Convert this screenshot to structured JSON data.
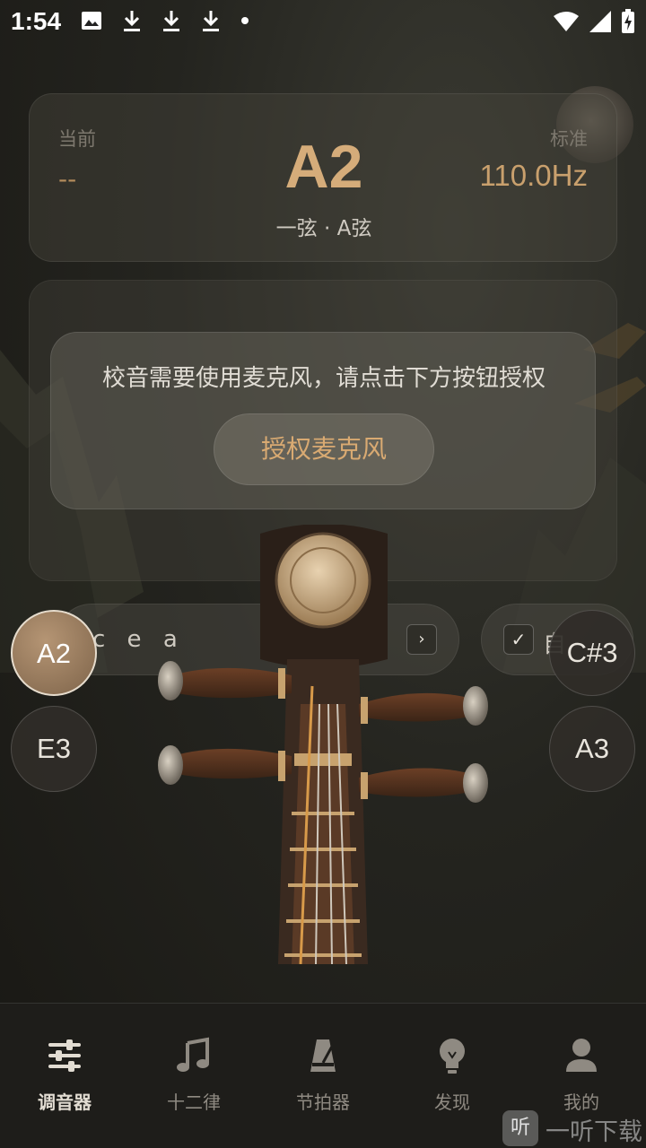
{
  "status_bar": {
    "time": "1:54",
    "left_icons": [
      "image-icon",
      "download-icon",
      "download-icon",
      "download-icon",
      "dot-icon"
    ],
    "right_icons": [
      "wifi-icon",
      "signal-icon",
      "battery-charging-icon"
    ]
  },
  "tuner": {
    "current_label": "当前",
    "current_value": "--",
    "standard_label": "标准",
    "standard_value": "110.0Hz",
    "note": "A2",
    "string_name": "一弦 · A弦"
  },
  "mic_prompt": {
    "message": "校音需要使用麦克风，请点击下方按钮授权",
    "button_label": "授权麦克风"
  },
  "tuning": {
    "value": "c e a",
    "arrow": "›",
    "auto_check": "✓",
    "auto_label": "自"
  },
  "strings": {
    "left_top": "A2",
    "left_bottom": "E3",
    "right_top": "C#3",
    "right_bottom": "A3",
    "selected": "A2"
  },
  "bottom_nav": {
    "items": [
      {
        "label": "调音器",
        "icon": "tuner-sliders-icon",
        "active": true
      },
      {
        "label": "十二律",
        "icon": "music-note-icon",
        "active": false
      },
      {
        "label": "节拍器",
        "icon": "metronome-icon",
        "active": false
      },
      {
        "label": "发现",
        "icon": "lightbulb-icon",
        "active": false
      },
      {
        "label": "我的",
        "icon": "person-icon",
        "active": false
      }
    ]
  },
  "watermark": {
    "icon_text": "听",
    "text": "一听下载"
  },
  "colors": {
    "accent_gold": "#d5ac7a",
    "background": "#1f1e1a",
    "active_string": "#9b7b5c"
  }
}
